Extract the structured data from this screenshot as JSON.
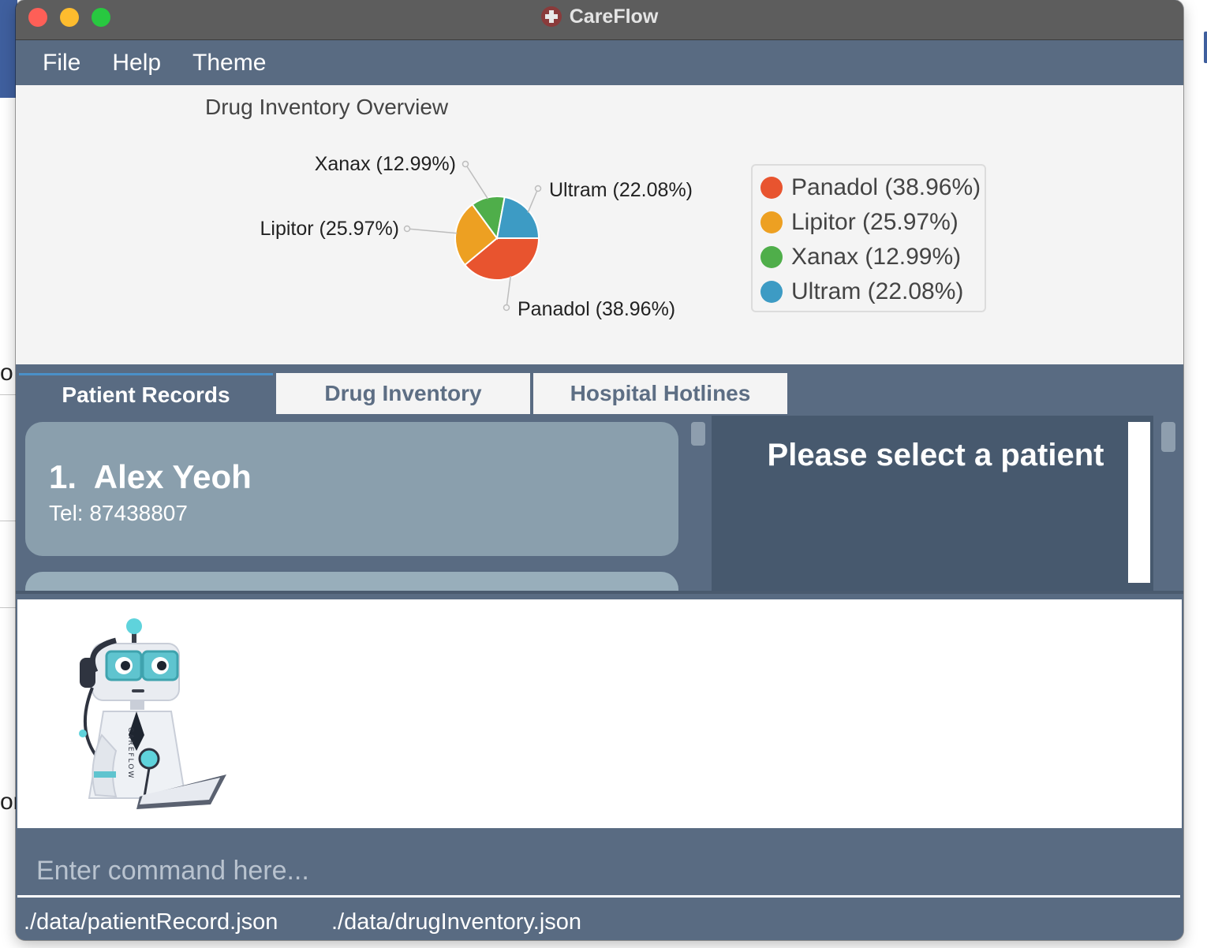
{
  "window": {
    "title": "CareFlow"
  },
  "menu": {
    "items": [
      "File",
      "Help",
      "Theme"
    ]
  },
  "chart_data": {
    "type": "pie",
    "title": "Drug Inventory Overview",
    "slices": [
      {
        "label": "Panadol (38.96%)",
        "value": 38.96,
        "color": "#e8542f"
      },
      {
        "label": "Lipitor (25.97%)",
        "value": 25.97,
        "color": "#eda022"
      },
      {
        "label": "Xanax (12.99%)",
        "value": 12.99,
        "color": "#4fae4a"
      },
      {
        "label": "Ultram (22.08%)",
        "value": 22.08,
        "color": "#3d9bc4"
      }
    ],
    "legend": {
      "position": "right",
      "entries": [
        "Panadol (38.96%)",
        "Lipitor (25.97%)",
        "Xanax (12.99%)",
        "Ultram (22.08%)"
      ]
    }
  },
  "tabs": [
    {
      "label": "Patient Records",
      "active": true
    },
    {
      "label": "Drug Inventory",
      "active": false
    },
    {
      "label": "Hospital Hotlines",
      "active": false
    }
  ],
  "patients": [
    {
      "name": "1.  Alex Yeoh",
      "tel": "Tel: 87438807"
    }
  ],
  "detail": {
    "placeholder": "Please select a patient"
  },
  "mascot": {
    "text": "CAREFLOW"
  },
  "command": {
    "placeholder": "Enter command here...",
    "value": ""
  },
  "status": {
    "patient_file": "./data/patientRecord.json",
    "drug_file": "./data/drugInventory.json"
  },
  "desktop": {
    "fragment_a": "o",
    "fragment_b": "or"
  }
}
